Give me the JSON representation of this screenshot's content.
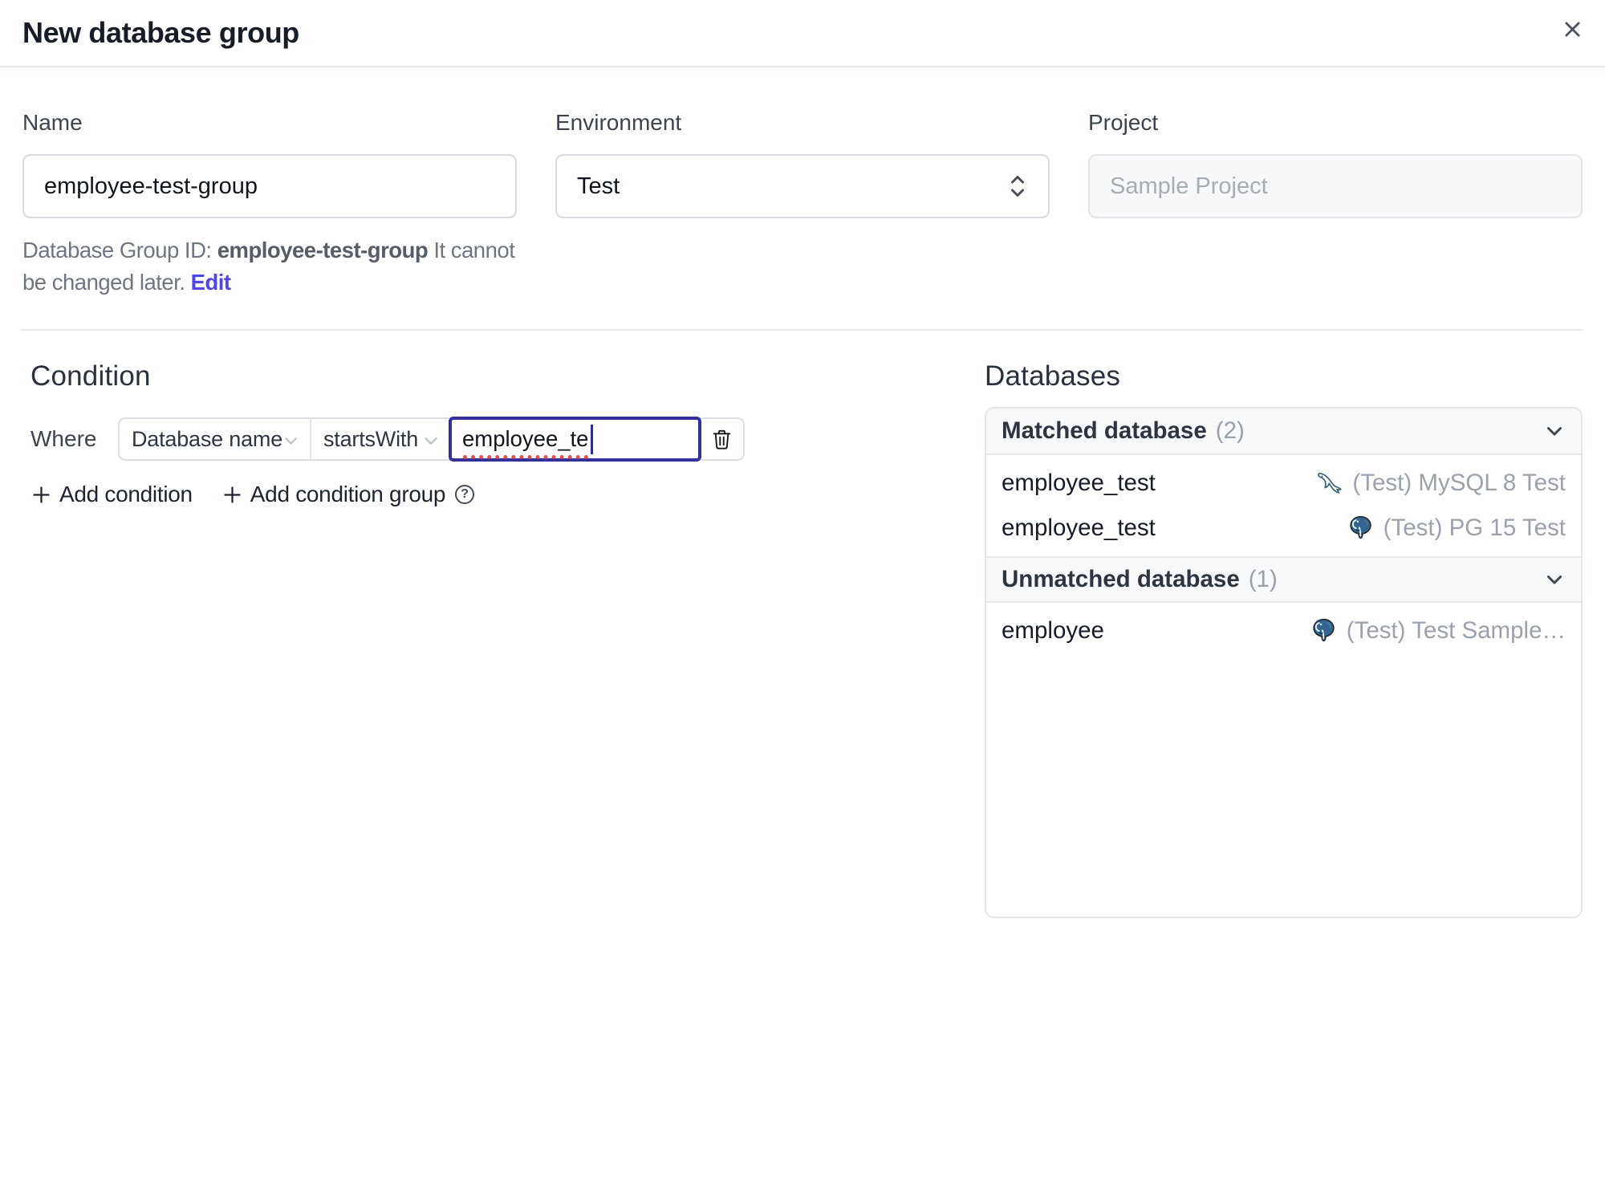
{
  "dialog": {
    "title": "New database group"
  },
  "form": {
    "name_label": "Name",
    "name_value": "employee-test-group",
    "environment_label": "Environment",
    "environment_value": "Test",
    "project_label": "Project",
    "project_value": "Sample Project",
    "group_id_prefix": "Database Group ID:",
    "group_id_value": "employee-test-group",
    "group_id_suffix": "It cannot be changed later.",
    "group_id_edit": "Edit"
  },
  "condition": {
    "heading": "Condition",
    "where_label": "Where",
    "factor_value": "Database name",
    "operator_value": "startsWith",
    "value_text": "employee_te",
    "add_condition": "Add condition",
    "add_condition_group": "Add condition group"
  },
  "databases": {
    "heading": "Databases",
    "matched_label": "Matched database",
    "matched_count": "(2)",
    "unmatched_label": "Unmatched database",
    "unmatched_count": "(1)",
    "rows": [
      {
        "name": "employee_test",
        "engine": "mysql",
        "instance": "(Test) MySQL 8 Test"
      },
      {
        "name": "employee_test",
        "engine": "postgres",
        "instance": "(Test) PG 15 Test"
      },
      {
        "name": "employee",
        "engine": "postgres",
        "instance": "(Test) Test Sample…"
      }
    ]
  },
  "icons": {
    "help": "?"
  },
  "colors": {
    "accent": "#4f46e5",
    "focus_border": "#33309b",
    "header_bg": "#f8f9fb",
    "border": "#e4e6ea",
    "mysql": "#3c6e8f",
    "postgres": "#336791"
  }
}
